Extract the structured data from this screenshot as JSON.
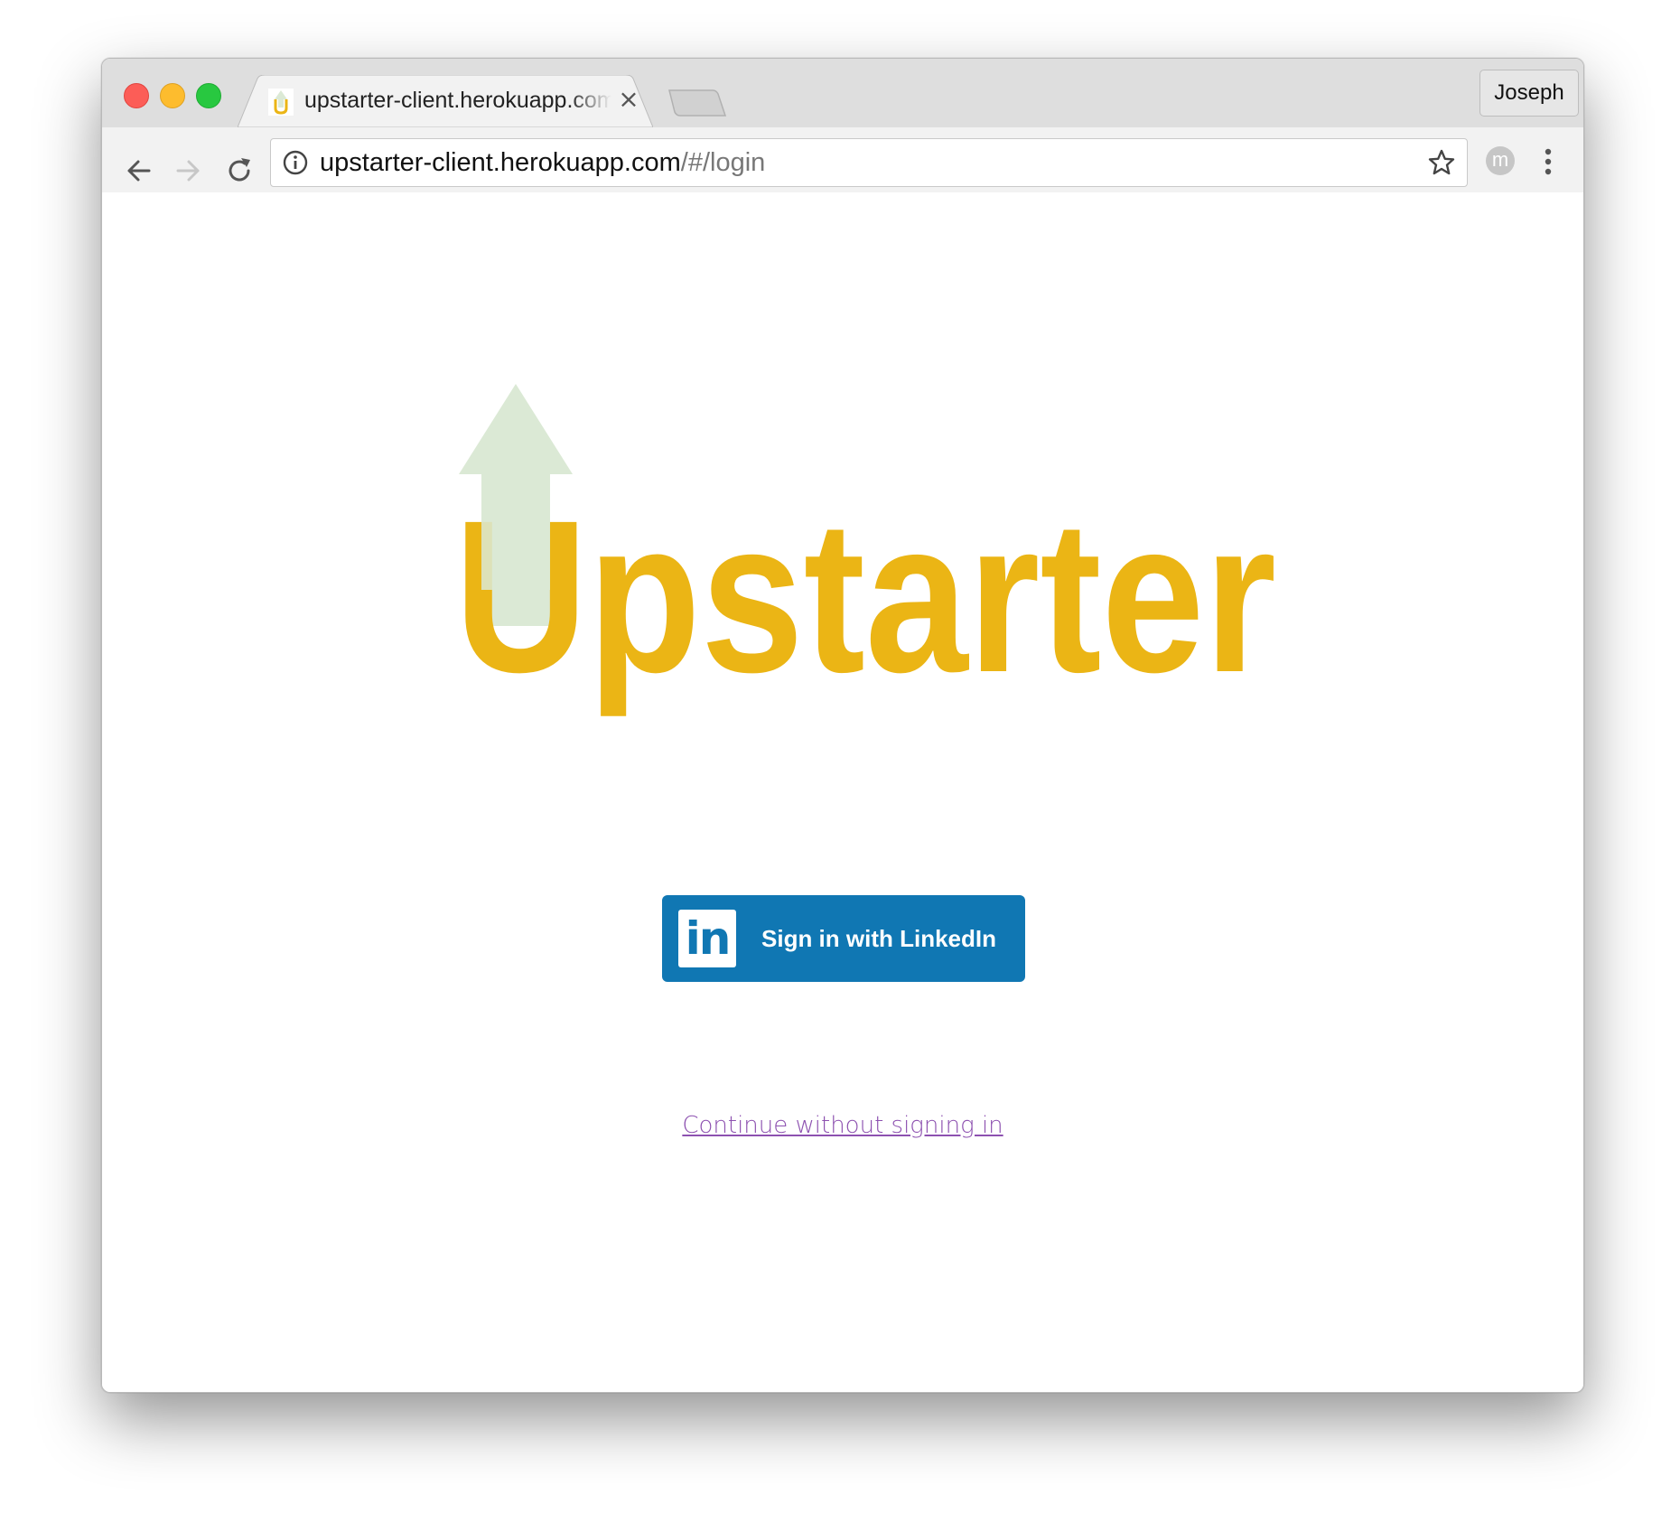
{
  "browser": {
    "tab": {
      "title": "upstarter-client.herokuapp.com",
      "close_glyph": "×"
    },
    "profile_name": "Joseph",
    "address_bar": {
      "host": "upstarter-client.herokuapp.com",
      "path": "/#/login"
    },
    "extension_letter": "m",
    "icons": [
      "back-arrow-icon",
      "forward-arrow-icon",
      "reload-icon",
      "info-icon",
      "bookmark-star-icon",
      "more-vert-icon"
    ]
  },
  "page": {
    "logo_text": "Upstarter",
    "logo_colors": {
      "text": "#ebb515",
      "arrow": "#dbe9d5"
    },
    "signin_button": {
      "logo_text": "in",
      "label": "Sign in with LinkedIn",
      "color": "#1077b3"
    },
    "continue_link": "Continue without signing in",
    "link_color": "#8d51b0"
  }
}
